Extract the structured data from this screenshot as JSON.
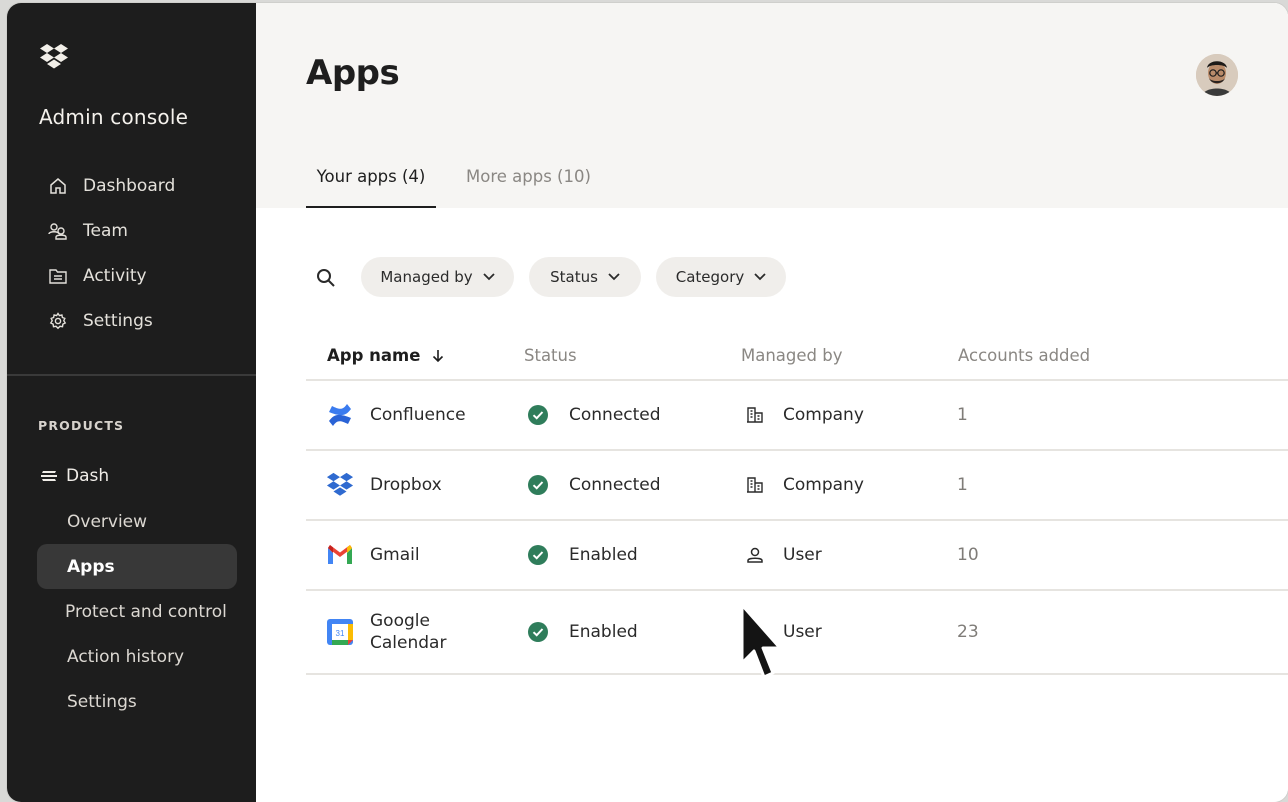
{
  "sidebar": {
    "console_title": "Admin console",
    "nav": [
      {
        "label": "Dashboard",
        "icon": "home-icon"
      },
      {
        "label": "Team",
        "icon": "team-icon"
      },
      {
        "label": "Activity",
        "icon": "activity-icon"
      },
      {
        "label": "Settings",
        "icon": "gear-icon"
      }
    ],
    "products_heading": "PRODUCTS",
    "product": {
      "label": "Dash",
      "icon": "dash-icon"
    },
    "product_items": [
      {
        "label": "Overview",
        "active": false
      },
      {
        "label": "Apps",
        "active": true
      },
      {
        "label": "Protect and control",
        "active": false
      },
      {
        "label": "Action history",
        "active": false
      },
      {
        "label": "Settings",
        "active": false
      }
    ]
  },
  "main": {
    "title": "Apps",
    "tabs": [
      {
        "label": "Your apps (4)",
        "active": true
      },
      {
        "label": "More apps (10)",
        "active": false
      }
    ],
    "filters": [
      "Managed by",
      "Status",
      "Category"
    ],
    "table": {
      "columns": [
        "App name",
        "Status",
        "Managed by",
        "Accounts added"
      ],
      "rows": [
        {
          "app": "Confluence",
          "app_icon": "confluence-icon",
          "status": "Connected",
          "managed_by": "Company",
          "manager_icon": "building-icon",
          "accounts": "1"
        },
        {
          "app": "Dropbox",
          "app_icon": "dropbox-icon",
          "status": "Connected",
          "managed_by": "Company",
          "manager_icon": "building-icon",
          "accounts": "1"
        },
        {
          "app": "Gmail",
          "app_icon": "gmail-icon",
          "status": "Enabled",
          "managed_by": "User",
          "manager_icon": "user-icon",
          "accounts": "10"
        },
        {
          "app_line1": "Google",
          "app_line2": "Calendar",
          "app_icon": "google-calendar-icon",
          "calendar_day": "31",
          "status": "Enabled",
          "managed_by": "User",
          "manager_icon": "user-icon",
          "accounts": "23"
        }
      ]
    }
  },
  "colors": {
    "sidebar_bg": "#1d1d1d",
    "header_bg": "#f6f5f3",
    "status_green": "#2f7d5b",
    "dropbox_blue": "#2f6ad0"
  }
}
